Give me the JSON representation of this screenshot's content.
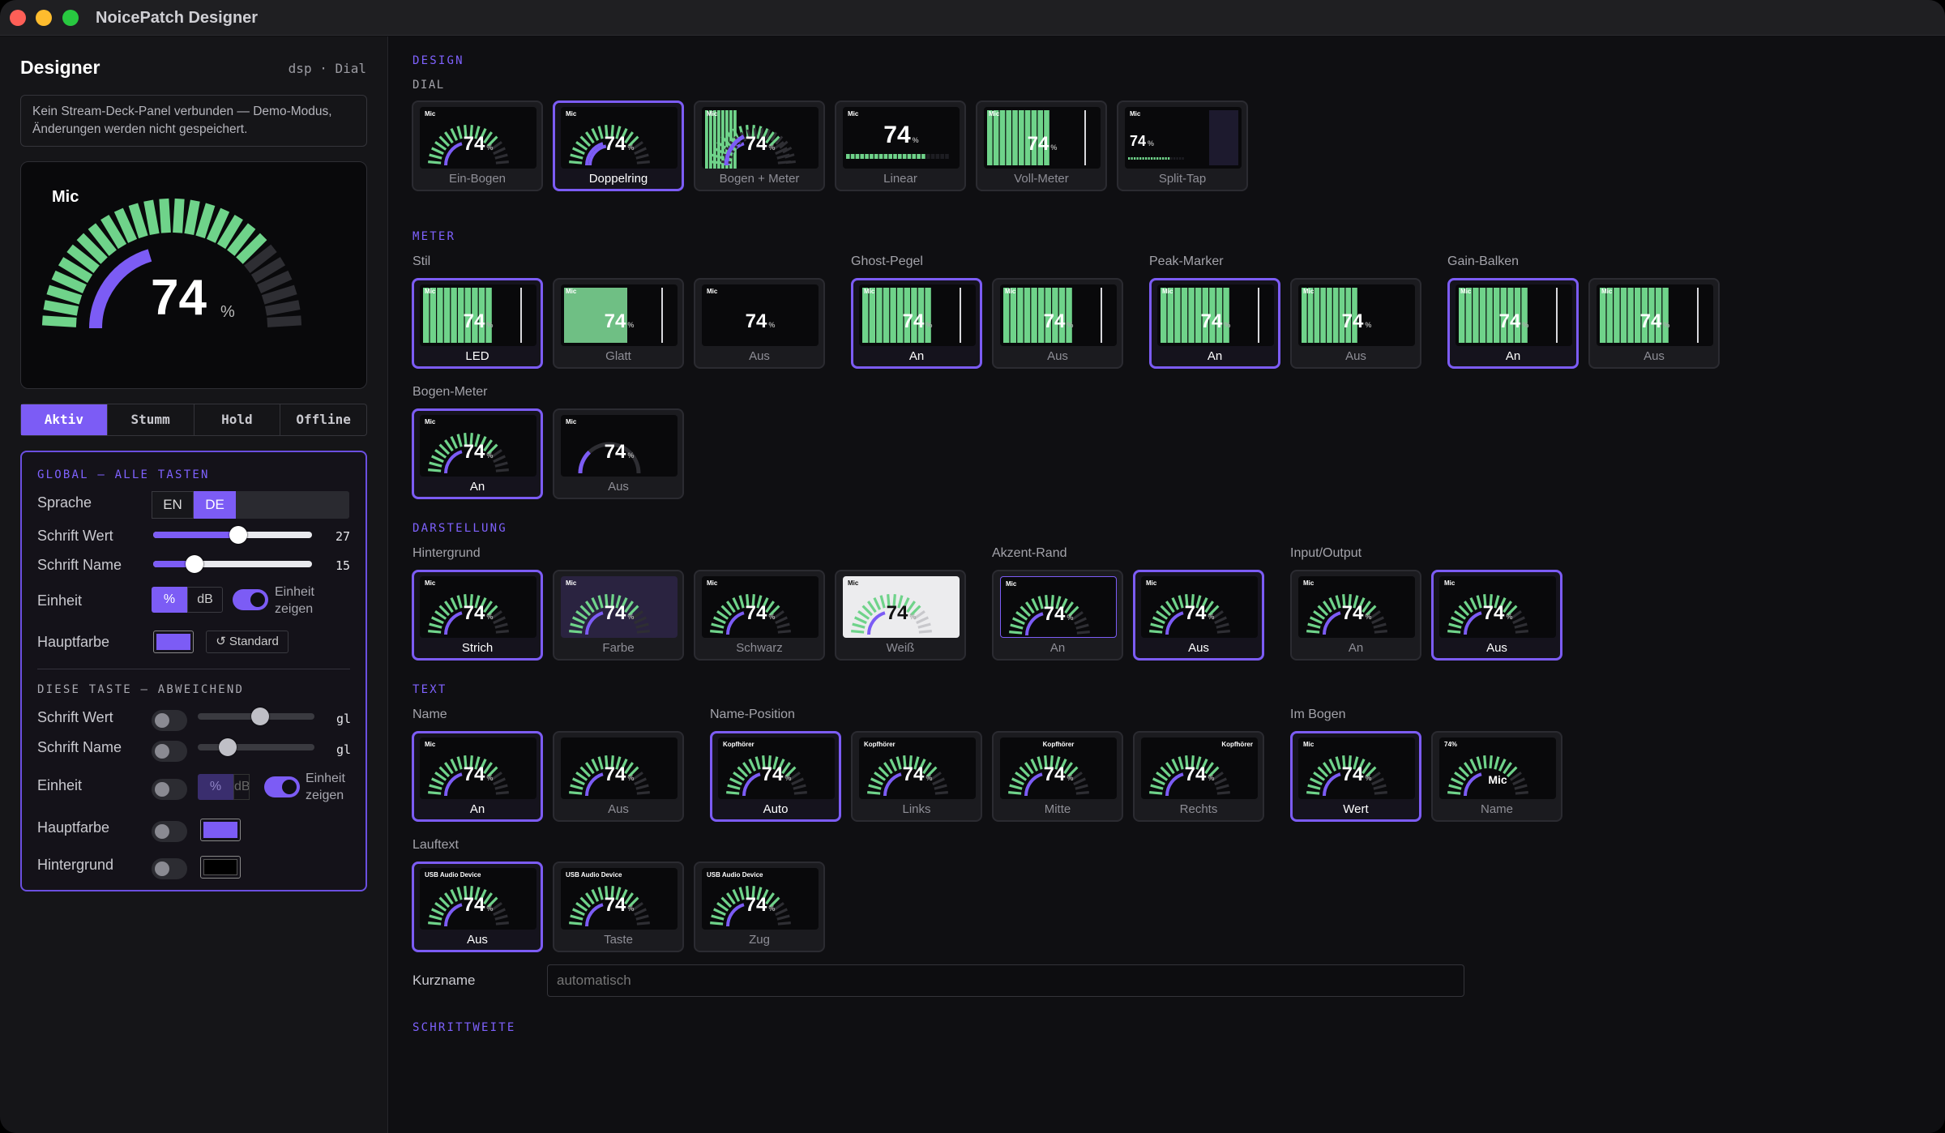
{
  "app": {
    "title": "NoicePatch Designer"
  },
  "sidebar": {
    "title": "Designer",
    "meta": "dsp · Dial",
    "notice": "Kein Stream-Deck-Panel verbunden — Demo-Modus, Änderungen werden nicht gespeichert.",
    "preview": {
      "name": "Mic",
      "value": "74",
      "unit": "%",
      "level": 0.74
    },
    "state_tabs": [
      "Aktiv",
      "Stumm",
      "Hold",
      "Offline"
    ],
    "global": {
      "heading": "GLOBAL — ALLE TASTEN",
      "lang_label": "Sprache",
      "lang_options": [
        "EN",
        "DE"
      ],
      "font_value_label": "Schrift Wert",
      "font_value": "27",
      "font_name_label": "Schrift Name",
      "font_name": "15",
      "unit_label": "Einheit",
      "unit_options": [
        "%",
        "dB"
      ],
      "unit_show": "Einheit zeigen",
      "color_label": "Hauptfarbe",
      "reset_label": "↺ Standard",
      "color": "#7c5cf5"
    },
    "override": {
      "heading": "DIESE TASTE — ABWEICHEND",
      "font_value_label": "Schrift Wert",
      "font_value_tag": "gl",
      "font_name_label": "Schrift Name",
      "font_name_tag": "gl",
      "unit_label": "Einheit",
      "unit_options": [
        "%",
        "dB"
      ],
      "unit_show": "Einheit zeigen",
      "color_label": "Hauptfarbe",
      "bg_label": "Hintergrund"
    }
  },
  "main": {
    "design": {
      "heading": "DESIGN",
      "dial_label": "DIAL",
      "tiles": [
        "Ein-Bogen",
        "Doppelring",
        "Bogen + Meter",
        "Linear",
        "Voll-Meter",
        "Split-Tap"
      ]
    },
    "meter": {
      "heading": "METER",
      "stil": {
        "label": "Stil",
        "tiles": [
          "LED",
          "Glatt",
          "Aus"
        ]
      },
      "ghost": {
        "label": "Ghost-Pegel",
        "tiles": [
          "An",
          "Aus"
        ]
      },
      "peak": {
        "label": "Peak-Marker",
        "tiles": [
          "An",
          "Aus"
        ]
      },
      "gain": {
        "label": "Gain-Balken",
        "tiles": [
          "An",
          "Aus"
        ]
      },
      "bogen": {
        "label": "Bogen-Meter",
        "tiles": [
          "An",
          "Aus"
        ]
      }
    },
    "darstellung": {
      "heading": "DARSTELLUNG",
      "bg": {
        "label": "Hintergrund",
        "tiles": [
          "Strich",
          "Farbe",
          "Schwarz",
          "Weiß"
        ]
      },
      "akzent": {
        "label": "Akzent-Rand",
        "tiles": [
          "An",
          "Aus"
        ]
      },
      "io": {
        "label": "Input/Output",
        "tiles": [
          "An",
          "Aus"
        ]
      }
    },
    "text": {
      "heading": "TEXT",
      "name": {
        "label": "Name",
        "tiles": [
          "An",
          "Aus"
        ]
      },
      "namepos": {
        "label": "Name-Position",
        "tiles": [
          "Auto",
          "Links",
          "Mitte",
          "Rechts"
        ]
      },
      "imbogen": {
        "label": "Im Bogen",
        "tiles": [
          "Wert",
          "Name"
        ]
      },
      "lauftext": {
        "label": "Lauftext",
        "tiles": [
          "Aus",
          "Taste",
          "Zug"
        ]
      },
      "kurzname_label": "Kurzname",
      "kurzname_placeholder": "automatisch"
    },
    "schrittweite": {
      "heading": "SCHRITTWEITE"
    },
    "tile_value": "74",
    "tile_unit": "%",
    "tile_name": "Mic",
    "tile_name_long": "Kopfhörer",
    "tile_device": "USB Audio Device",
    "tile_inarc_value": "74%"
  },
  "colors": {
    "accent": "#7c5cf5",
    "green": "#6fd38a"
  }
}
